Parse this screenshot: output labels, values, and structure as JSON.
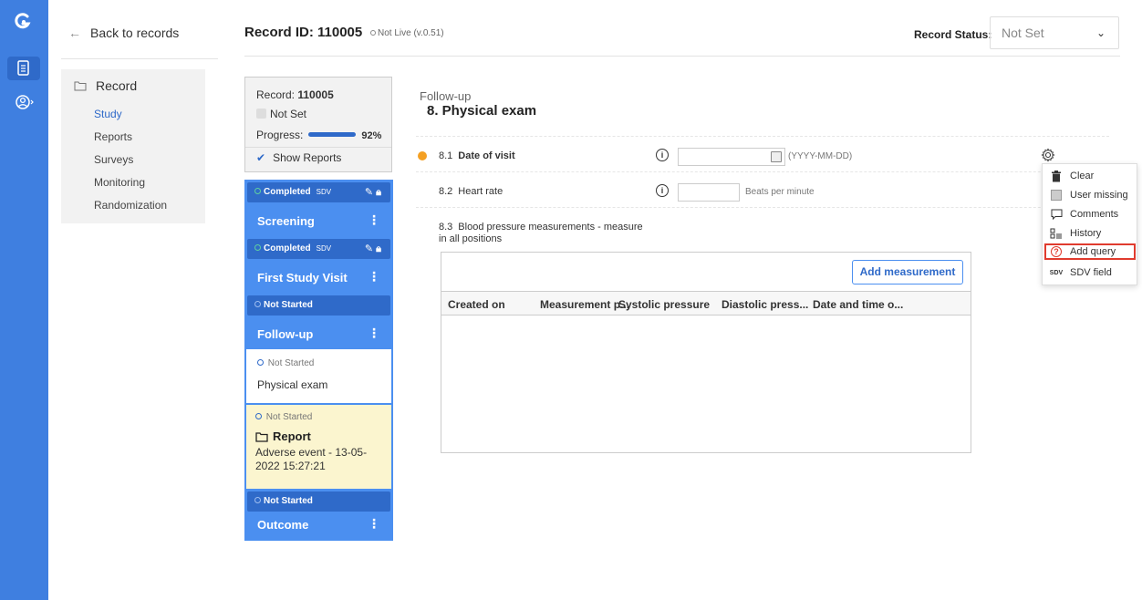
{
  "nav": {
    "back_label": "Back to records",
    "section_title": "Record",
    "items": [
      {
        "label": "Study",
        "active": true
      },
      {
        "label": "Reports",
        "active": false
      },
      {
        "label": "Surveys",
        "active": false
      },
      {
        "label": "Monitoring",
        "active": false
      },
      {
        "label": "Randomization",
        "active": false
      }
    ]
  },
  "header": {
    "record_id_label": "Record ID: 110005",
    "live_status": "Not Live (v.0.51)",
    "record_status_label": "Record Status:",
    "record_status_value": "Not Set"
  },
  "record_panel": {
    "record_label": "Record: ",
    "record_value": "110005",
    "status": "Not Set",
    "progress_label": "Progress:",
    "progress_value": 0.92,
    "progress_text": "92%",
    "show_reports_label": "Show Reports"
  },
  "events": [
    {
      "status": "Completed",
      "sdv": "SDV",
      "name": "Screening"
    },
    {
      "status": "Completed",
      "sdv": "SDV",
      "name": "First Study Visit"
    },
    {
      "status": "Not Started",
      "name": "Follow-up"
    },
    {
      "status": "Not Started",
      "name": "Outcome"
    }
  ],
  "forms": {
    "physical_exam": {
      "status": "Not Started",
      "name": "Physical exam"
    },
    "report": {
      "status": "Not Started",
      "title": "Report",
      "description": "Adverse event - 13-05-2022 15:27:21"
    }
  },
  "form": {
    "subtitle": "Follow-up",
    "title": "8. Physical exam",
    "questions": [
      {
        "num": "8.1",
        "label": "Date of visit",
        "hint": "(YYYY-MM-DD)",
        "value": ""
      },
      {
        "num": "8.2",
        "label": "Heart rate",
        "hint": "Beats per minute",
        "value": ""
      },
      {
        "num": "8.3",
        "label": "Blood pressure measurements - measure in all positions"
      }
    ],
    "add_measurement_label": "Add measurement",
    "table_columns": [
      "Created on",
      "Measurement p...",
      "Systolic pressure",
      "Diastolic press...",
      "Date and time o..."
    ]
  },
  "menu": {
    "items": [
      {
        "label": "Clear",
        "icon": "trash-icon"
      },
      {
        "label": "User missing",
        "icon": "checkbox-icon"
      },
      {
        "label": "Comments",
        "icon": "comment-icon"
      },
      {
        "label": "History",
        "icon": "history-icon"
      },
      {
        "label": "Add query",
        "icon": "question-icon",
        "highlighted": true
      },
      {
        "label": "SDV field",
        "icon": "sdv-icon"
      }
    ]
  },
  "icons": {
    "info_glyph": "i",
    "query_glyph": "?",
    "sdv_glyph": "SDV"
  },
  "colors": {
    "brand_blue": "#3f7fe0",
    "event_blue": "#4b8ff0",
    "event_bar_blue": "#2f6ac9",
    "required_orange": "#f4a023",
    "highlight_red": "#e03b2e",
    "report_yellow": "#fbf5cf"
  }
}
